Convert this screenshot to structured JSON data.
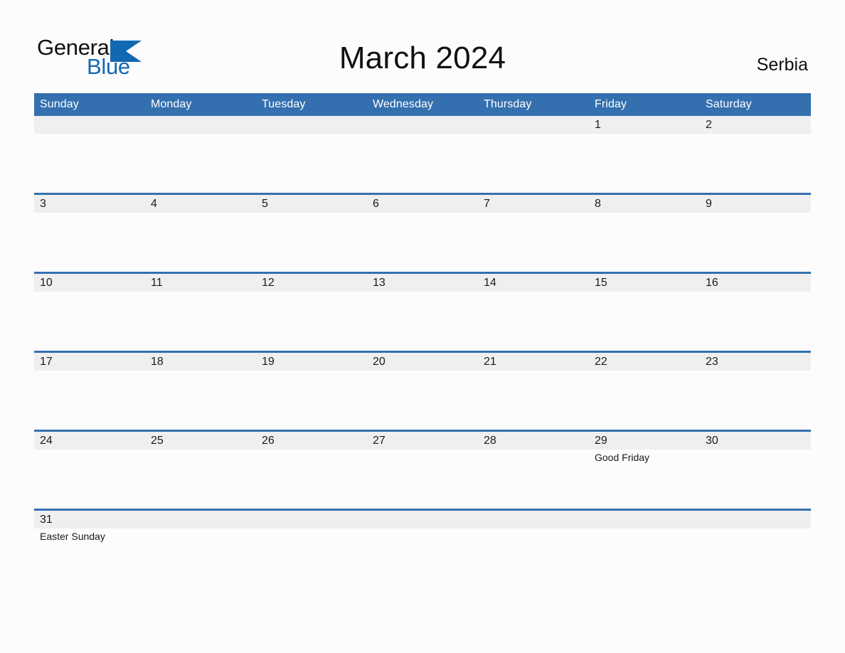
{
  "brand": {
    "name_part1": "General",
    "name_part2": "Blue",
    "triangle_icon": "triangle-icon",
    "color_black": "#111111",
    "color_blue": "#1168b3"
  },
  "header": {
    "title": "March 2024",
    "region": "Serbia"
  },
  "theme": {
    "header_blue": "#3470AF",
    "band_gray": "#efefef",
    "page_background": "#fcfcfc",
    "text": "#1a1a1a"
  },
  "calendar": {
    "month": "March",
    "year": "2024",
    "weekday_headers": [
      "Sunday",
      "Monday",
      "Tuesday",
      "Wednesday",
      "Thursday",
      "Friday",
      "Saturday"
    ],
    "weeks": [
      {
        "days": [
          {
            "num": "",
            "events": []
          },
          {
            "num": "",
            "events": []
          },
          {
            "num": "",
            "events": []
          },
          {
            "num": "",
            "events": []
          },
          {
            "num": "",
            "events": []
          },
          {
            "num": "1",
            "events": []
          },
          {
            "num": "2",
            "events": []
          }
        ]
      },
      {
        "days": [
          {
            "num": "3",
            "events": []
          },
          {
            "num": "4",
            "events": []
          },
          {
            "num": "5",
            "events": []
          },
          {
            "num": "6",
            "events": []
          },
          {
            "num": "7",
            "events": []
          },
          {
            "num": "8",
            "events": []
          },
          {
            "num": "9",
            "events": []
          }
        ]
      },
      {
        "days": [
          {
            "num": "10",
            "events": []
          },
          {
            "num": "11",
            "events": []
          },
          {
            "num": "12",
            "events": []
          },
          {
            "num": "13",
            "events": []
          },
          {
            "num": "14",
            "events": []
          },
          {
            "num": "15",
            "events": []
          },
          {
            "num": "16",
            "events": []
          }
        ]
      },
      {
        "days": [
          {
            "num": "17",
            "events": []
          },
          {
            "num": "18",
            "events": []
          },
          {
            "num": "19",
            "events": []
          },
          {
            "num": "20",
            "events": []
          },
          {
            "num": "21",
            "events": []
          },
          {
            "num": "22",
            "events": []
          },
          {
            "num": "23",
            "events": []
          }
        ]
      },
      {
        "days": [
          {
            "num": "24",
            "events": []
          },
          {
            "num": "25",
            "events": []
          },
          {
            "num": "26",
            "events": []
          },
          {
            "num": "27",
            "events": []
          },
          {
            "num": "28",
            "events": []
          },
          {
            "num": "29",
            "events": [
              "Good Friday"
            ]
          },
          {
            "num": "30",
            "events": []
          }
        ]
      },
      {
        "days": [
          {
            "num": "31",
            "events": [
              "Easter Sunday"
            ]
          },
          {
            "num": "",
            "events": []
          },
          {
            "num": "",
            "events": []
          },
          {
            "num": "",
            "events": []
          },
          {
            "num": "",
            "events": []
          },
          {
            "num": "",
            "events": []
          },
          {
            "num": "",
            "events": []
          }
        ]
      }
    ]
  }
}
